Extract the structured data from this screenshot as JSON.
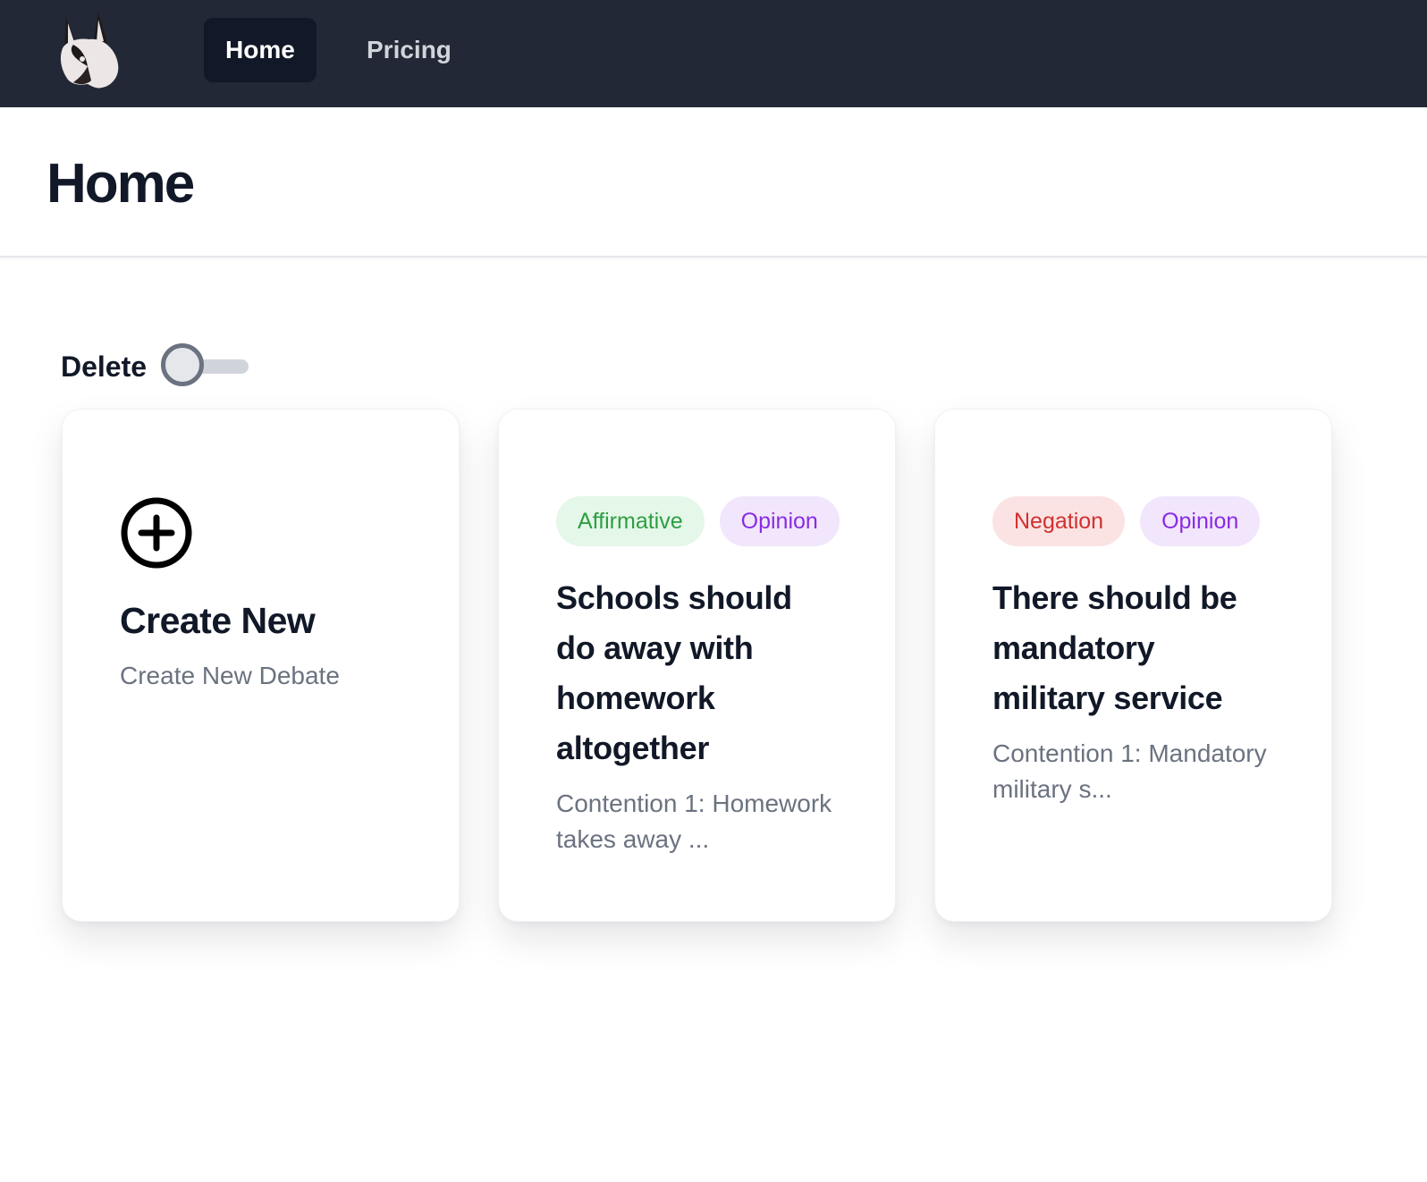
{
  "nav": {
    "logo_icon": "fox-head-logo",
    "links": [
      {
        "label": "Home",
        "active": true
      },
      {
        "label": "Pricing",
        "active": false
      }
    ]
  },
  "header": {
    "title": "Home"
  },
  "controls": {
    "delete_label": "Delete",
    "delete_toggle_on": false
  },
  "cards": {
    "create": {
      "icon": "plus-circle-icon",
      "title": "Create New",
      "subtitle": "Create New Debate"
    },
    "debates": [
      {
        "tags": [
          "Affirmative",
          "Opinion"
        ],
        "title": "Schools should do away with homework altogether",
        "excerpt": "Contention 1: Homework takes away ..."
      },
      {
        "tags": [
          "Negation",
          "Opinion"
        ],
        "title": "There should be mandatory military service",
        "excerpt": "Contention 1: Mandatory military s..."
      }
    ]
  },
  "colors": {
    "nav_bg": "#222836",
    "nav_active_bg": "#111827",
    "affirmative_bg": "#e4f7e8",
    "affirmative_text": "#2f9e44",
    "negation_bg": "#fbe3e3",
    "negation_text": "#d1302f",
    "opinion_bg": "#f1e6fb",
    "opinion_text": "#8a2be2"
  }
}
